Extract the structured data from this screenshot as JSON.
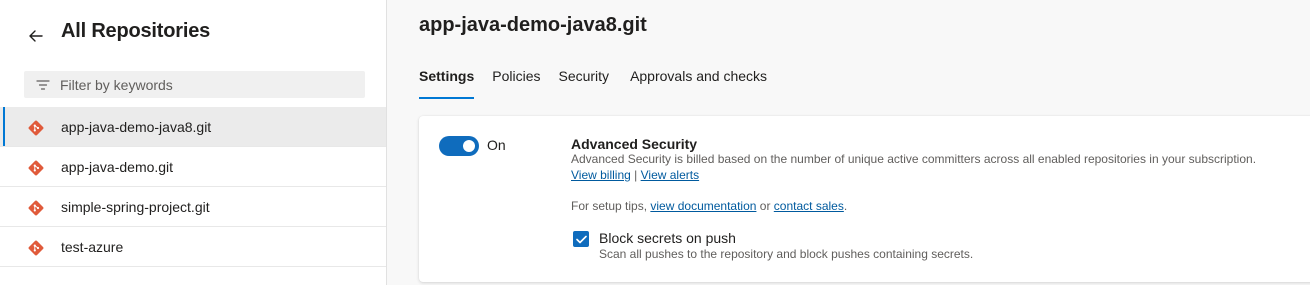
{
  "sidebar": {
    "back_icon": "arrow-left-icon",
    "title": "All Repositories",
    "filter": {
      "placeholder": "Filter by keywords",
      "value": "",
      "icon": "filter-icon"
    },
    "repos": [
      {
        "name": "app-java-demo-java8.git",
        "selected": true,
        "icon": "git-repo-icon"
      },
      {
        "name": "app-java-demo.git",
        "selected": false,
        "icon": "git-repo-icon"
      },
      {
        "name": "simple-spring-project.git",
        "selected": false,
        "icon": "git-repo-icon"
      },
      {
        "name": "test-azure",
        "selected": false,
        "icon": "git-repo-icon"
      }
    ]
  },
  "main": {
    "title": "app-java-demo-java8.git",
    "tabs": [
      {
        "label": "Settings",
        "active": true
      },
      {
        "label": "Policies",
        "active": false
      },
      {
        "label": "Security",
        "active": false
      },
      {
        "label": "Approvals and checks",
        "active": false
      }
    ],
    "advanced_security": {
      "toggle_label": "On",
      "toggle_on": true,
      "title": "Advanced Security",
      "description": "Advanced Security is billed based on the number of unique active committers across all enabled repositories in your subscription.",
      "view_billing": "View billing",
      "separator": "|",
      "view_alerts": "View alerts",
      "tips_prefix": "For setup tips,",
      "view_documentation": "view documentation",
      "tips_or": "or",
      "contact_sales": "contact sales",
      "tips_suffix": ".",
      "block_secrets_label": "Block secrets on push",
      "block_secrets_checked": true,
      "block_secrets_desc": "Scan all pushes to the repository and block pushes containing secrets."
    }
  },
  "colors": {
    "accent": "#0078d4",
    "toggle": "#0f6cbd",
    "git_icon": "#e05a3a",
    "link": "#005a9e"
  }
}
